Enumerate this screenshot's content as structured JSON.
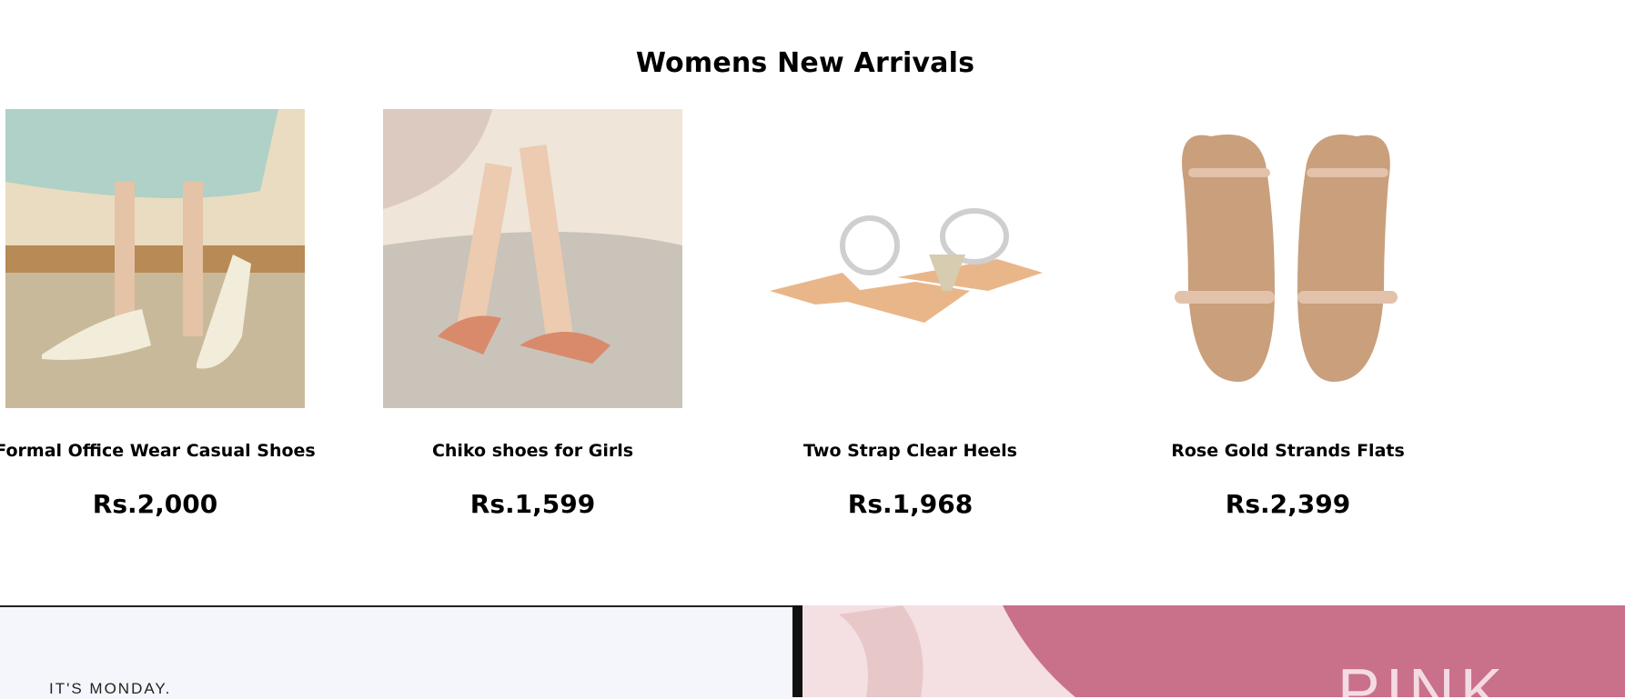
{
  "section": {
    "title": "Womens New Arrivals"
  },
  "products": [
    {
      "name": "Formal Office Wear Casual Shoes",
      "price": "Rs.2,000",
      "icon": "slingback-pump-image"
    },
    {
      "name": "Chiko shoes for Girls",
      "price": "Rs.1,599",
      "icon": "block-heel-sandal-image"
    },
    {
      "name": "Two Strap Clear Heels",
      "price": "Rs.1,968",
      "icon": "clear-strap-heels-image"
    },
    {
      "name": "Rose Gold Strands Flats",
      "price": "Rs.2,399",
      "icon": "rose-gold-flats-image"
    }
  ],
  "banners": {
    "left": {
      "tagline": "IT'S MONDAY."
    },
    "right": {
      "headline": "PINK"
    }
  },
  "colors": {
    "background": "#ffffff",
    "text": "#000000",
    "banner_left_bg": "#f4f6fb",
    "banner_right_bg": "#c9708a"
  }
}
